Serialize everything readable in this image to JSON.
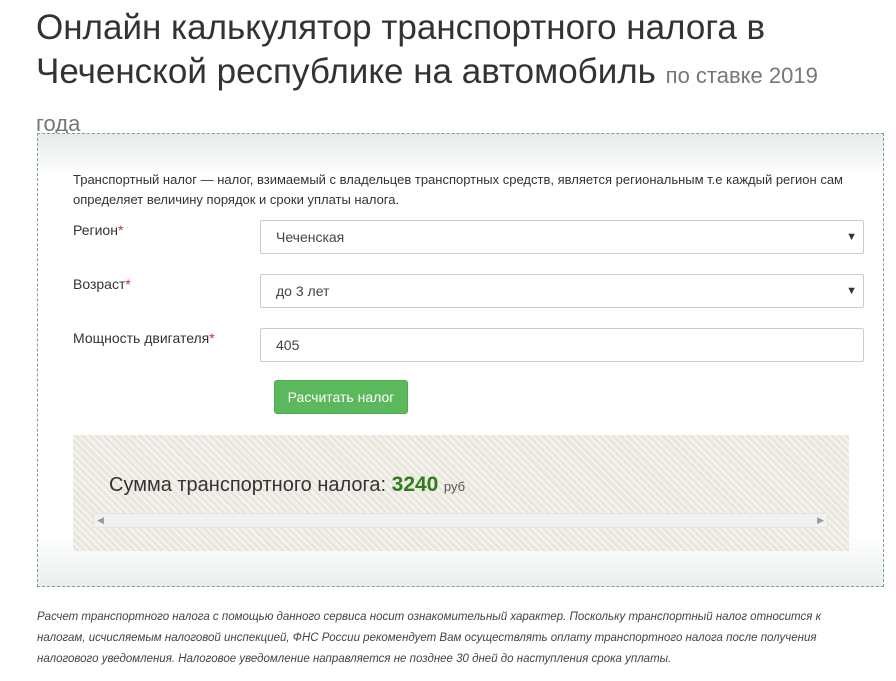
{
  "header": {
    "title": "Онлайн калькулятор транспортного налога в Чеченской республике на автомобиль",
    "subtitle": "по ставке 2019 года"
  },
  "intro": "Транспортный налог — налог, взимаемый с владельцев транспортных средств, является региональным т.е каждый регион сам определяет величину порядок и сроки уплаты налога.",
  "form": {
    "required_mark": "*",
    "region": {
      "label": "Регион",
      "value": "Чеченская"
    },
    "age": {
      "label": "Возраст",
      "value": "до 3 лет"
    },
    "power": {
      "label": "Мощность двигателя",
      "value": "405"
    },
    "submit_label": "Расчитать налог"
  },
  "result": {
    "label": "Сумма транспортного налога:",
    "amount": "3240",
    "unit": "руб"
  },
  "icons": {
    "select_arrow": "▼",
    "scroll_left": "◀",
    "scroll_right": "▶"
  },
  "disclaimer": "Расчет транспортного налога с помощью данного сервиса носит ознакомительный характер. Поскольку транспортный налог относится к налогам, исчисляемым налоговой инспекцией, ФНС России рекомендует Вам осуществлять оплату транспортного налога после получения налогового уведомления. Налоговое уведомление направляется не позднее 30 дней до наступления срока уплаты.",
  "colors": {
    "accent_green": "#5cb85c",
    "amount_green": "#2e7d1a",
    "required_red": "#c9302c"
  }
}
